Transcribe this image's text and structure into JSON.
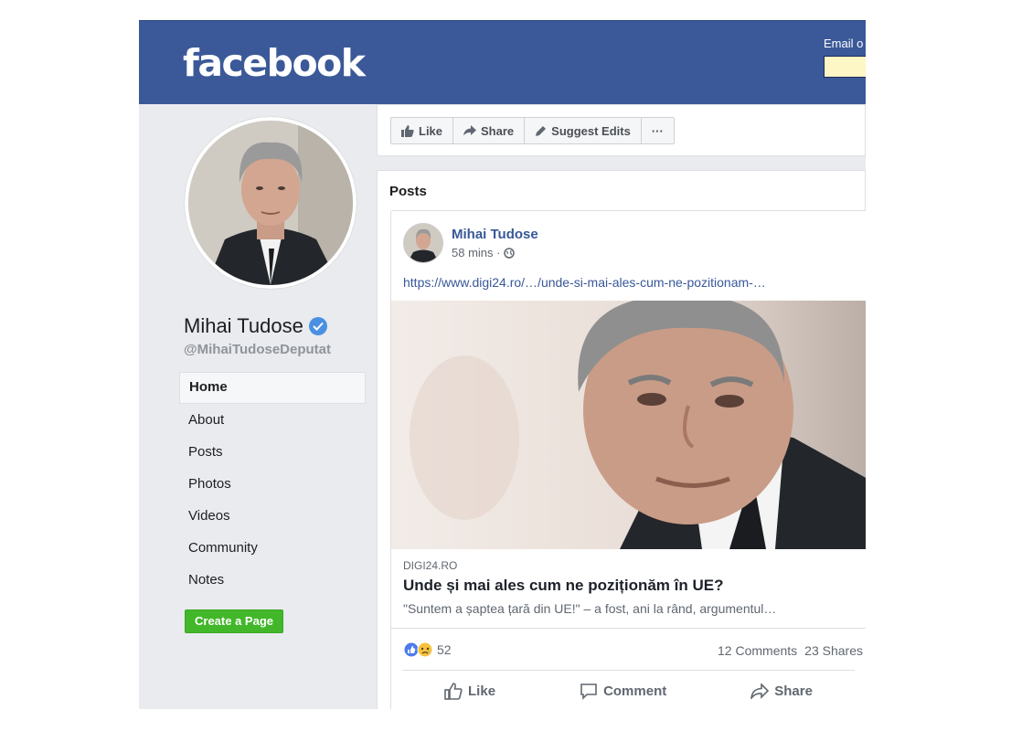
{
  "header": {
    "logo": "facebook",
    "login_label": "Email o"
  },
  "profile": {
    "name": "Mihai Tudose",
    "handle": "@MihaiTudoseDeputat",
    "verified": true
  },
  "sidebar": {
    "items": [
      {
        "label": "Home",
        "active": true
      },
      {
        "label": "About"
      },
      {
        "label": "Posts"
      },
      {
        "label": "Photos"
      },
      {
        "label": "Videos"
      },
      {
        "label": "Community"
      },
      {
        "label": "Notes"
      }
    ],
    "create_page": "Create a Page"
  },
  "action_bar": {
    "like": "Like",
    "share": "Share",
    "suggest_edits": "Suggest Edits",
    "more": "···"
  },
  "posts": {
    "title": "Posts",
    "post": {
      "author": "Mihai Tudose",
      "time": "58 mins ·",
      "link_url": "https://www.digi24.ro/…/unde-si-mai-ales-cum-ne-pozitionam-…",
      "domain": "DIGI24.RO",
      "link_title": "Unde și mai ales cum ne poziționăm în UE?",
      "link_desc": "\"Suntem a șaptea țară din UE!\" – a fost, ani la rând, argumentul…",
      "reaction_count": "52",
      "comments": "12 Comments",
      "shares": "23 Shares",
      "actions": {
        "like": "Like",
        "comment": "Comment",
        "share": "Share"
      }
    }
  },
  "colors": {
    "brand_blue": "#3b5998",
    "link_blue": "#385898",
    "create_green": "#42b72a",
    "page_bg": "#e9ebee"
  }
}
